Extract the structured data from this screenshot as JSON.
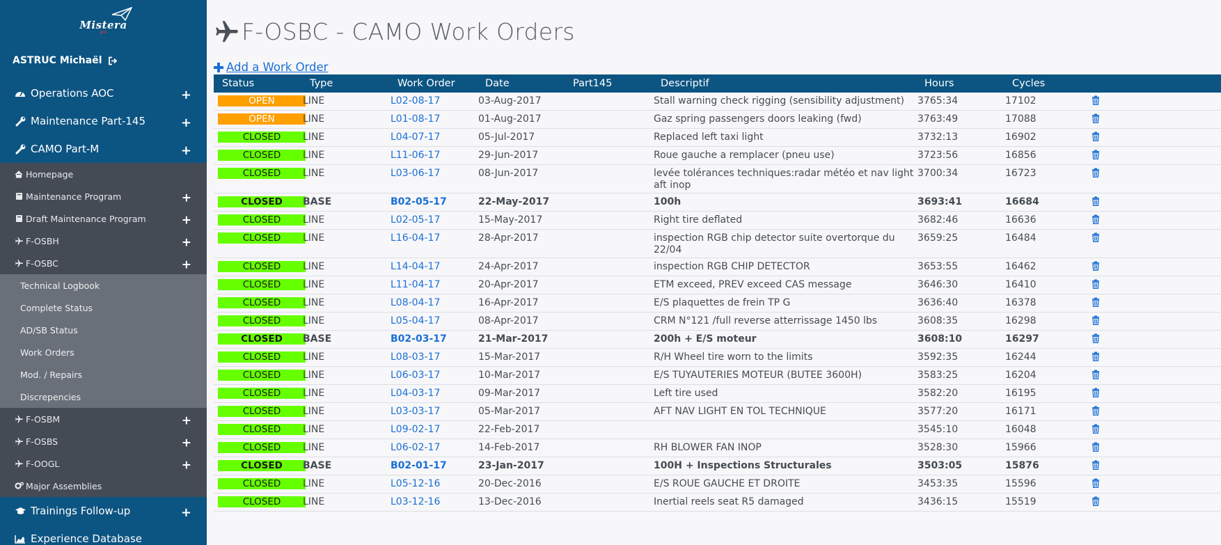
{
  "sidebar": {
    "logo_text": "Mistera",
    "logo_sub": "pro",
    "user": {
      "name": "ASTRUC Michaël",
      "logout_icon": "sign-out-icon"
    },
    "main_top": [
      {
        "label": "Operations AOC",
        "icon": "dashboard-icon"
      },
      {
        "label": "Maintenance Part-145",
        "icon": "wrench-icon"
      },
      {
        "label": "CAMO Part-M",
        "icon": "wrench-icon"
      }
    ],
    "sub": [
      {
        "label": "Homepage",
        "icon": "home-icon"
      },
      {
        "label": "Maintenance Program",
        "icon": "book-icon"
      },
      {
        "label": "Draft Maintenance Program",
        "icon": "book-icon"
      },
      {
        "label": "F-OSBH",
        "icon": "plane-icon"
      },
      {
        "label": "F-OSBC",
        "icon": "plane-icon"
      }
    ],
    "leaves": [
      "Technical Logbook",
      "Complete Status",
      "AD/SB Status",
      "Work Orders",
      "Mod. / Repairs",
      "Discrepencies"
    ],
    "sub_after": [
      {
        "label": "F-OSBM",
        "icon": "plane-icon"
      },
      {
        "label": "F-OSBS",
        "icon": "plane-icon"
      },
      {
        "label": "F-OOGL",
        "icon": "plane-icon"
      },
      {
        "label": "Major Assemblies",
        "icon": "cogs-icon"
      }
    ],
    "main_bottom": [
      {
        "label": "Trainings Follow-up",
        "icon": "graduation-cap-icon"
      },
      {
        "label": "Experience Database",
        "icon": "area-chart-icon"
      }
    ]
  },
  "page": {
    "title": "F-OSBC - CAMO Work Orders",
    "add_label": "Add a Work Order"
  },
  "table": {
    "headers": [
      "Status",
      "Type",
      "Work Order",
      "Date",
      "Part145",
      "Descriptif",
      "Hours",
      "Cycles",
      ""
    ],
    "rows": [
      {
        "status": "OPEN",
        "type": "LINE",
        "wo": "L02-08-17",
        "date": "03-Aug-2017",
        "part145": "",
        "desc": "Stall warning check rigging (sensibility adjustment)",
        "hours": "3765:34",
        "cycles": "17102",
        "bold": false
      },
      {
        "status": "OPEN",
        "type": "LINE",
        "wo": "L01-08-17",
        "date": "01-Aug-2017",
        "part145": "",
        "desc": "Gaz spring passengers doors leaking (fwd)",
        "hours": "3763:49",
        "cycles": "17088",
        "bold": false
      },
      {
        "status": "CLOSED",
        "type": "LINE",
        "wo": "L04-07-17",
        "date": "05-Jul-2017",
        "part145": "",
        "desc": "Replaced left taxi light",
        "hours": "3732:13",
        "cycles": "16902",
        "bold": false
      },
      {
        "status": "CLOSED",
        "type": "LINE",
        "wo": "L11-06-17",
        "date": "29-Jun-2017",
        "part145": "",
        "desc": "Roue gauche a remplacer (pneu use)",
        "hours": "3723:56",
        "cycles": "16856",
        "bold": false
      },
      {
        "status": "CLOSED",
        "type": "LINE",
        "wo": "L03-06-17",
        "date": "08-Jun-2017",
        "part145": "",
        "desc": "levée tolérances techniques:radar météo et nav light aft inop",
        "hours": "3700:34",
        "cycles": "16723",
        "bold": false
      },
      {
        "status": "CLOSED",
        "type": "BASE",
        "wo": "B02-05-17",
        "date": "22-May-2017",
        "part145": "",
        "desc": "100h",
        "hours": "3693:41",
        "cycles": "16684",
        "bold": true
      },
      {
        "status": "CLOSED",
        "type": "LINE",
        "wo": "L02-05-17",
        "date": "15-May-2017",
        "part145": "",
        "desc": "Right tire deflated",
        "hours": "3682:46",
        "cycles": "16636",
        "bold": false
      },
      {
        "status": "CLOSED",
        "type": "LINE",
        "wo": "L16-04-17",
        "date": "28-Apr-2017",
        "part145": "",
        "desc": "inspection RGB chip detector suite overtorque du 22/04",
        "hours": "3659:25",
        "cycles": "16484",
        "bold": false
      },
      {
        "status": "CLOSED",
        "type": "LINE",
        "wo": "L14-04-17",
        "date": "24-Apr-2017",
        "part145": "",
        "desc": "inspection RGB CHIP DETECTOR",
        "hours": "3653:55",
        "cycles": "16462",
        "bold": false
      },
      {
        "status": "CLOSED",
        "type": "LINE",
        "wo": "L11-04-17",
        "date": "20-Apr-2017",
        "part145": "",
        "desc": "ETM exceed, PREV exceed CAS message",
        "hours": "3646:30",
        "cycles": "16410",
        "bold": false
      },
      {
        "status": "CLOSED",
        "type": "LINE",
        "wo": "L08-04-17",
        "date": "16-Apr-2017",
        "part145": "",
        "desc": "E/S plaquettes de frein TP G",
        "hours": "3636:40",
        "cycles": "16378",
        "bold": false
      },
      {
        "status": "CLOSED",
        "type": "LINE",
        "wo": "L05-04-17",
        "date": "08-Apr-2017",
        "part145": "",
        "desc": "CRM N°121 /full reverse atterrissage 1450 lbs",
        "hours": "3608:35",
        "cycles": "16298",
        "bold": false
      },
      {
        "status": "CLOSED",
        "type": "BASE",
        "wo": "B02-03-17",
        "date": "21-Mar-2017",
        "part145": "",
        "desc": "200h + E/S moteur",
        "hours": "3608:10",
        "cycles": "16297",
        "bold": true
      },
      {
        "status": "CLOSED",
        "type": "LINE",
        "wo": "L08-03-17",
        "date": "15-Mar-2017",
        "part145": "",
        "desc": "R/H Wheel tire worn to the limits",
        "hours": "3592:35",
        "cycles": "16244",
        "bold": false
      },
      {
        "status": "CLOSED",
        "type": "LINE",
        "wo": "L06-03-17",
        "date": "10-Mar-2017",
        "part145": "",
        "desc": "E/S TUYAUTERIES MOTEUR (BUTEE 3600H)",
        "hours": "3583:25",
        "cycles": "16204",
        "bold": false
      },
      {
        "status": "CLOSED",
        "type": "LINE",
        "wo": "L04-03-17",
        "date": "09-Mar-2017",
        "part145": "",
        "desc": "Left tire used",
        "hours": "3582:20",
        "cycles": "16195",
        "bold": false
      },
      {
        "status": "CLOSED",
        "type": "LINE",
        "wo": "L03-03-17",
        "date": "05-Mar-2017",
        "part145": "",
        "desc": "AFT NAV LIGHT EN TOL TECHNIQUE",
        "hours": "3577:20",
        "cycles": "16171",
        "bold": false
      },
      {
        "status": "CLOSED",
        "type": "LINE",
        "wo": "L09-02-17",
        "date": "22-Feb-2017",
        "part145": "",
        "desc": "",
        "hours": "3545:10",
        "cycles": "16048",
        "bold": false
      },
      {
        "status": "CLOSED",
        "type": "LINE",
        "wo": "L06-02-17",
        "date": "14-Feb-2017",
        "part145": "",
        "desc": "RH BLOWER FAN INOP",
        "hours": "3528:30",
        "cycles": "15966",
        "bold": false
      },
      {
        "status": "CLOSED",
        "type": "BASE",
        "wo": "B02-01-17",
        "date": "23-Jan-2017",
        "part145": "",
        "desc": "100H + Inspections Structurales",
        "hours": "3503:05",
        "cycles": "15876",
        "bold": true
      },
      {
        "status": "CLOSED",
        "type": "LINE",
        "wo": "L05-12-16",
        "date": "20-Dec-2016",
        "part145": "",
        "desc": "E/S ROUE GAUCHE ET DROITE",
        "hours": "3453:35",
        "cycles": "15596",
        "bold": false
      },
      {
        "status": "CLOSED",
        "type": "LINE",
        "wo": "L03-12-16",
        "date": "13-Dec-2016",
        "part145": "",
        "desc": "Inertial reels seat R5 damaged",
        "hours": "3436:15",
        "cycles": "15519",
        "bold": false
      }
    ]
  },
  "colors": {
    "sidebar": "#0c5482",
    "submenu": "#454b55",
    "leafmenu": "#6a7079",
    "open": "#ff9f00",
    "closed": "#66ff00",
    "link": "#1a6fd6"
  }
}
